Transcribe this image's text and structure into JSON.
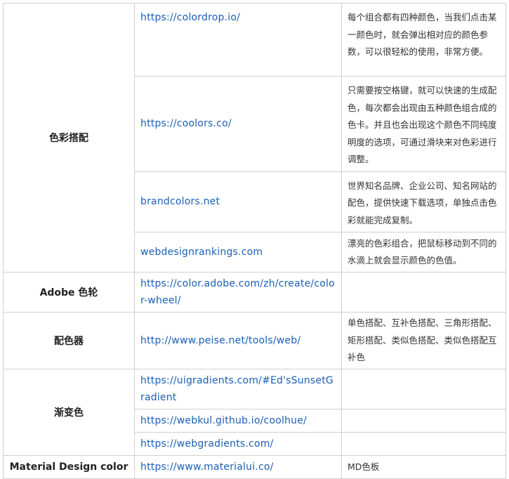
{
  "rows": [
    {
      "category": "色彩搭配",
      "url": "https://colordrop.io/",
      "desc": "每个组合都有四种颜色，当我们点击某一颜色时，就会弹出相对应的颜色参数，可以很轻松的使用，非常方便。"
    },
    {
      "url": "https://coolors.co/",
      "desc": "只需要按空格键，就可以快速的生成配色，每次都会出现由五种颜色组合成的色卡。并且也会出现这个颜色不同纯度明度的选项，可通过滑块来对色彩进行调整。"
    },
    {
      "url": "brandcolors.net",
      "desc": "世界知名品牌、企业公司、知名网站的配色，提供快速下载选项，单独点击色彩就能完成复制。"
    },
    {
      "url": "webdesignrankings.com",
      "desc": "漂亮的色彩组合，把鼠标移动到不同的水滴上就会显示颜色的色值。"
    },
    {
      "category": "Adobe 色轮",
      "url": "https://color.adobe.com/zh/create/color-wheel/",
      "desc": ""
    },
    {
      "category": "配色器",
      "url": "http://www.peise.net/tools/web/",
      "desc": "单色搭配、互补色搭配、三角形搭配、矩形搭配、类似色搭配、类似色搭配互补色"
    },
    {
      "category": "渐变色",
      "url": "https://uigradients.com/#Ed'sSunsetGradient",
      "desc": ""
    },
    {
      "url": "https://webkul.github.io/coolhue/",
      "desc": ""
    },
    {
      "url": "https://webgradients.com/",
      "desc": ""
    },
    {
      "category": "Material Design color",
      "url": "https://www.materialui.co/",
      "desc": "MD色板"
    }
  ]
}
